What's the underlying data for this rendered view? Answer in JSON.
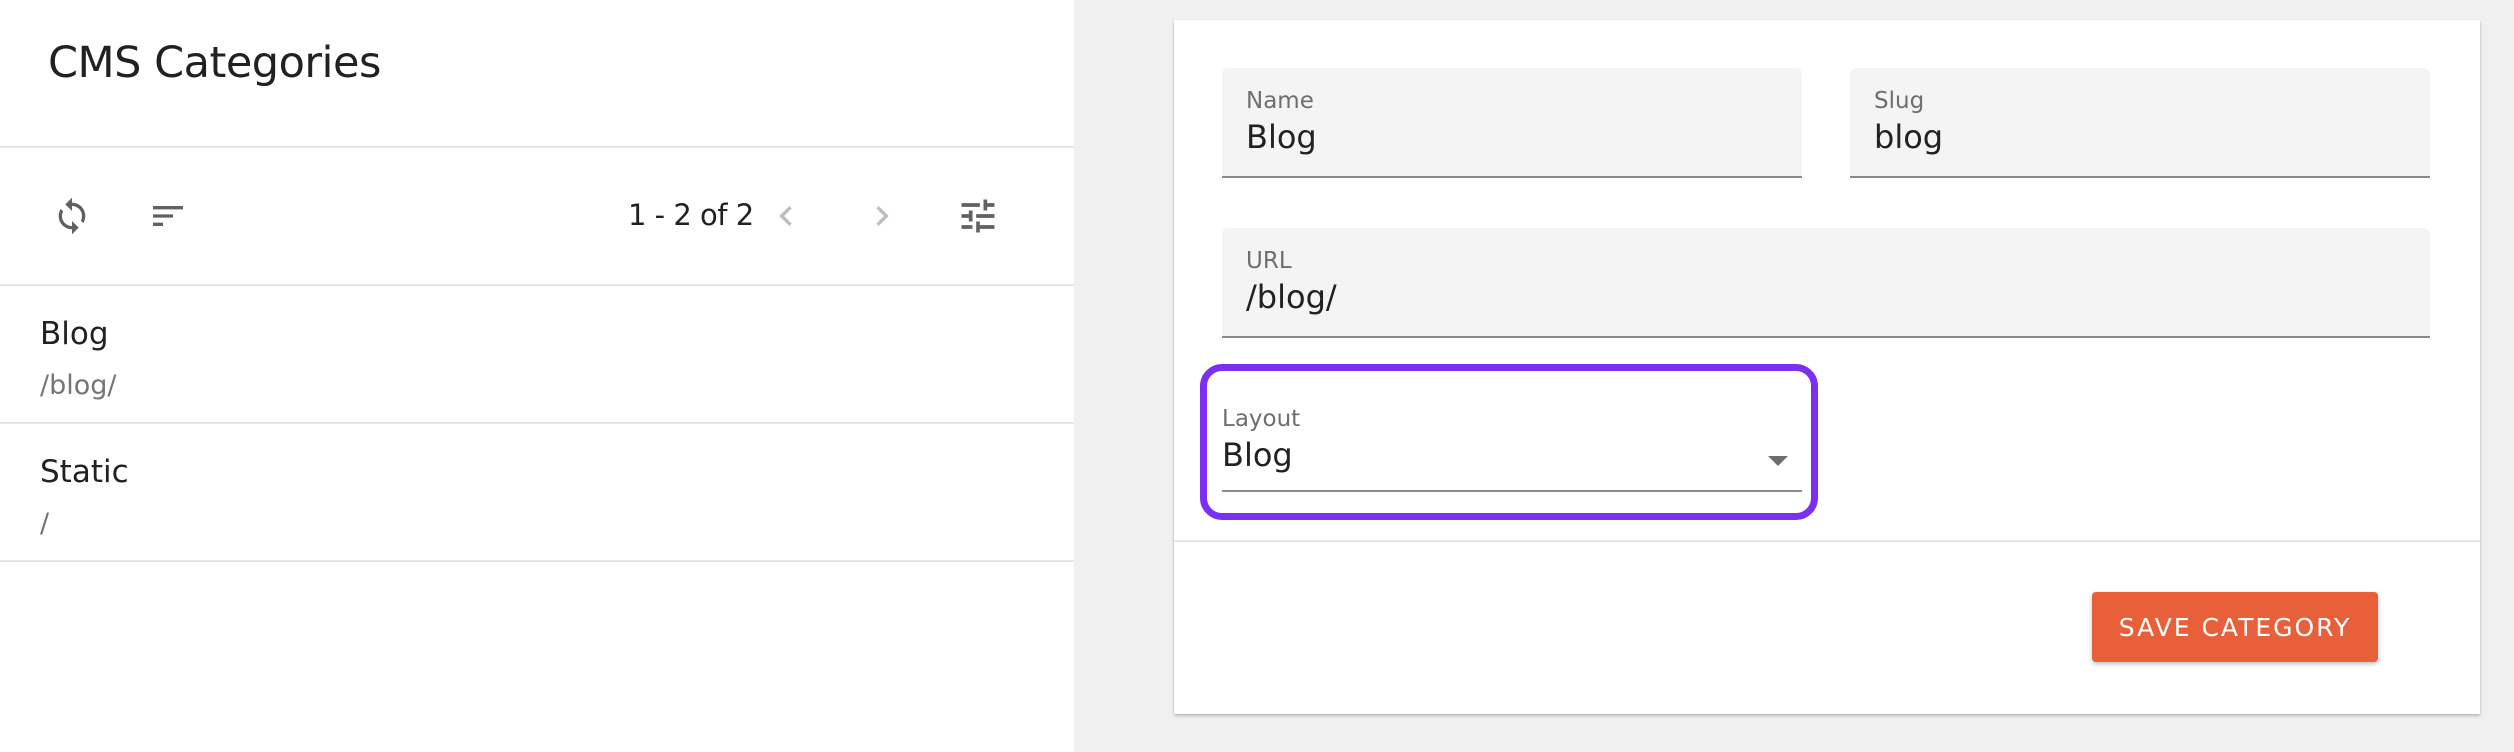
{
  "header": {
    "title": "CMS Categories"
  },
  "toolbar": {
    "refresh_icon": "refresh-icon",
    "sort_icon": "sort-icon",
    "pagination": "1 - 2 of 2",
    "prev_icon": "chevron-left-icon",
    "next_icon": "chevron-right-icon",
    "filter_icon": "tune-icon"
  },
  "categories": [
    {
      "title": "Blog",
      "subtitle": "/blog/"
    },
    {
      "title": "Static",
      "subtitle": "/"
    }
  ],
  "form": {
    "name": {
      "label": "Name",
      "value": "Blog"
    },
    "slug": {
      "label": "Slug",
      "value": "blog"
    },
    "url": {
      "label": "URL",
      "value": "/blog/"
    },
    "layout": {
      "label": "Layout",
      "value": "Blog"
    },
    "save_label": "SAVE CATEGORY"
  },
  "colors": {
    "accent": "#e8603a",
    "highlight": "#7b2ff0",
    "background": "#f0f0f0"
  }
}
